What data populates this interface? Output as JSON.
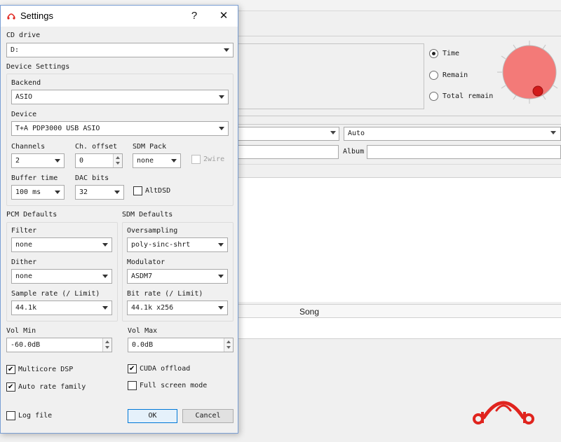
{
  "main": {
    "radios": [
      {
        "label": "Time",
        "checked": true
      },
      {
        "label": "Remain",
        "checked": false
      },
      {
        "label": "Total remain",
        "checked": false
      }
    ],
    "combo_auto": "Auto",
    "album_label": "Album",
    "list_header_song": "Song"
  },
  "dialog": {
    "title": "Settings",
    "help_button": "?",
    "close_button": "✕",
    "cd_drive": {
      "label": "CD drive",
      "value": "D:"
    },
    "device_settings": {
      "title": "Device Settings",
      "backend": {
        "label": "Backend",
        "value": "ASIO"
      },
      "device": {
        "label": "Device",
        "value": "T+A PDP3000 USB ASIO"
      },
      "channels": {
        "label": "Channels",
        "value": "2"
      },
      "ch_offset": {
        "label": "Ch. offset",
        "value": "0"
      },
      "sdm_pack": {
        "label": "SDM Pack",
        "value": "none"
      },
      "two_wire": {
        "label": "2wire",
        "checked": false,
        "disabled": true
      },
      "buffer_time": {
        "label": "Buffer time",
        "value": "100 ms"
      },
      "dac_bits": {
        "label": "DAC bits",
        "value": "32"
      },
      "alt_dsd": {
        "label": "AltDSD",
        "checked": false
      }
    },
    "pcm_defaults": {
      "title": "PCM Defaults",
      "filter": {
        "label": "Filter",
        "value": "none"
      },
      "dither": {
        "label": "Dither",
        "value": "none"
      },
      "sample_rate": {
        "label": "Sample rate (/ Limit)",
        "value": "44.1k"
      }
    },
    "sdm_defaults": {
      "title": "SDM Defaults",
      "oversampling": {
        "label": "Oversampling",
        "value": "poly-sinc-shrt"
      },
      "modulator": {
        "label": "Modulator",
        "value": "ASDM7"
      },
      "bit_rate": {
        "label": "Bit rate (/ Limit)",
        "value": "44.1k x256"
      }
    },
    "vol_min": {
      "label": "Vol Min",
      "value": "-60.0dB"
    },
    "vol_max": {
      "label": "Vol Max",
      "value": "0.0dB"
    },
    "multicore_dsp": {
      "label": "Multicore DSP",
      "checked": true
    },
    "cuda_offload": {
      "label": "CUDA offload",
      "checked": true
    },
    "auto_rate_family": {
      "label": "Auto rate family",
      "checked": true
    },
    "full_screen_mode": {
      "label": "Full screen mode",
      "checked": false
    },
    "log_file": {
      "label": "Log file",
      "checked": false
    },
    "ok_button": "OK",
    "cancel_button": "Cancel"
  },
  "colors": {
    "knob_fill": "#f37a78",
    "knob_dot": "#d11a1a",
    "logo_red": "#e0241e",
    "dialog_border": "#7a9fd4"
  }
}
